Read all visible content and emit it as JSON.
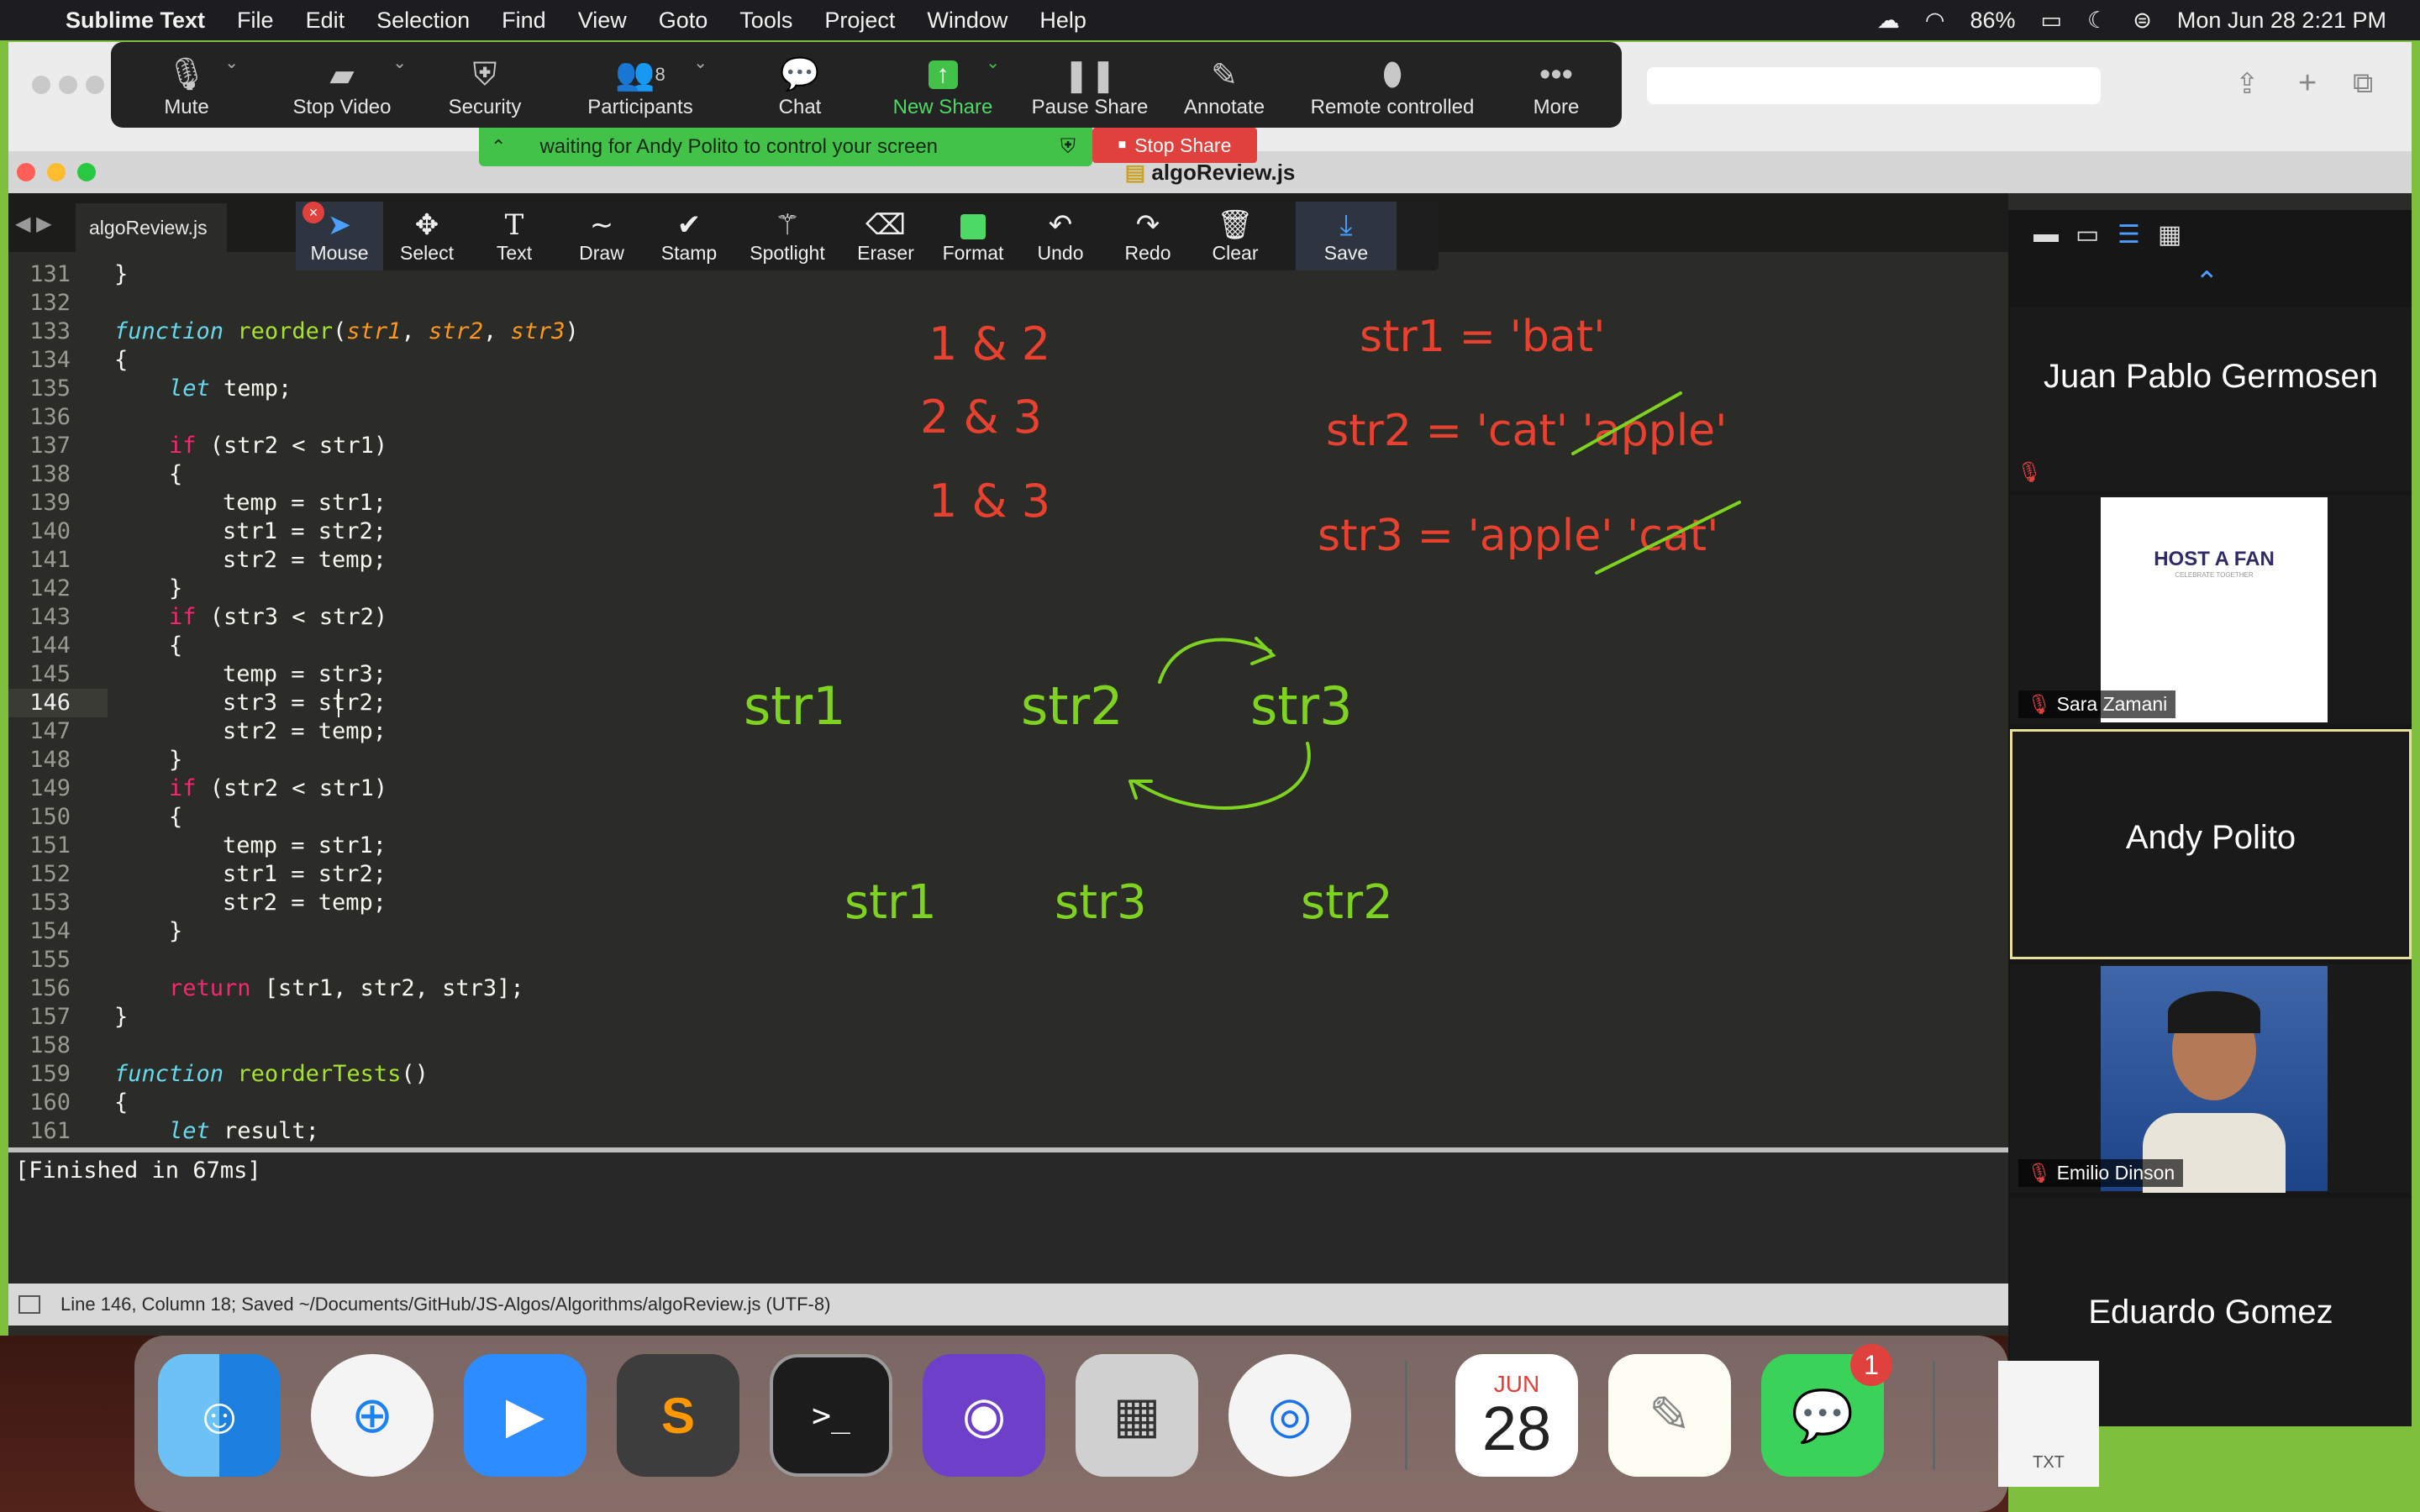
{
  "menubar": {
    "apple": "",
    "app_name": "Sublime Text",
    "items": [
      "File",
      "Edit",
      "Selection",
      "Find",
      "View",
      "Goto",
      "Tools",
      "Project",
      "Window",
      "Help"
    ],
    "battery": "86%",
    "datetime": "Mon Jun 28  2:21 PM"
  },
  "zoom_toolbar": {
    "buttons": [
      {
        "label": "Mute",
        "icon": "microphone-icon"
      },
      {
        "label": "Stop Video",
        "icon": "video-camera-icon"
      },
      {
        "label": "Security",
        "icon": "shield-icon"
      },
      {
        "label": "Participants",
        "icon": "participants-icon",
        "count": "8"
      },
      {
        "label": "Chat",
        "icon": "chat-bubble-icon"
      },
      {
        "label": "New Share",
        "icon": "share-up-arrow-icon"
      },
      {
        "label": "Pause Share",
        "icon": "pause-icon"
      },
      {
        "label": "Annotate",
        "icon": "pen-icon"
      },
      {
        "label": "Remote controlled",
        "icon": "mouse-icon"
      },
      {
        "label": "More",
        "icon": "more-dots-icon"
      }
    ]
  },
  "share_banner": {
    "text": "waiting for Andy Polito to control your screen",
    "stop_label": "Stop Share"
  },
  "window": {
    "title": "algoReview.js",
    "tab": "algoReview.js"
  },
  "annotate_toolbar": {
    "tools": [
      {
        "label": "Mouse",
        "icon": "cursor-arrow-icon"
      },
      {
        "label": "Select",
        "icon": "move-arrows-icon"
      },
      {
        "label": "Text",
        "icon": "text-T-icon"
      },
      {
        "label": "Draw",
        "icon": "squiggle-icon"
      },
      {
        "label": "Stamp",
        "icon": "checkmark-icon"
      },
      {
        "label": "Spotlight",
        "icon": "magic-wand-icon"
      },
      {
        "label": "Eraser",
        "icon": "eraser-icon"
      },
      {
        "label": "Format",
        "icon": "green-square-icon"
      },
      {
        "label": "Undo",
        "icon": "undo-icon"
      },
      {
        "label": "Redo",
        "icon": "redo-icon"
      },
      {
        "label": "Clear",
        "icon": "trash-icon"
      },
      {
        "label": "Save",
        "icon": "download-icon"
      }
    ]
  },
  "editor": {
    "line_numbers": [
      "131",
      "132",
      "133",
      "134",
      "135",
      "136",
      "137",
      "138",
      "139",
      "140",
      "141",
      "142",
      "143",
      "144",
      "145",
      "146",
      "147",
      "148",
      "149",
      "150",
      "151",
      "152",
      "153",
      "154",
      "155",
      "156",
      "157",
      "158",
      "159",
      "160",
      "161"
    ],
    "current_line": "146",
    "code": {
      "l131": "}",
      "l133_kw": "function",
      "l133_name": "reorder",
      "l133_p1": "str1",
      "l133_p2": "str2",
      "l133_p3": "str3",
      "open_brace": "{",
      "close_brace": "}",
      "let": "let",
      "temp_decl": " temp;",
      "if": "if",
      "cond1": " (str2 < str1)",
      "cond2": " (str3 < str2)",
      "temp_eq_str1": "temp = str1;",
      "str1_eq_str2": "str1 = str2;",
      "str2_eq_temp": "str2 = temp;",
      "temp_eq_str3": "temp = str3;",
      "str3_eq_str2": "str3 = str2;",
      "return": "return",
      "return_val": " [str1, str2, str3];",
      "l159_name": "reorderTests",
      "l159_tail": "()",
      "result_decl": " result;"
    }
  },
  "handwriting": {
    "red": [
      "1 & 2",
      "2 & 3",
      "1 & 3",
      "str1 = 'bat'",
      "str2 = 'cat' 'apple'",
      "str3 = 'apple' 'cat'"
    ],
    "green": [
      "str1",
      "str2",
      "str3",
      "str1",
      "str3",
      "str2"
    ]
  },
  "console": {
    "output": "[Finished in 67ms]"
  },
  "statusbar": {
    "text": "Line 146, Column 18; Saved ~/Documents/GitHub/JS-Algos/Algorithms/algoReview.js (UTF-8)"
  },
  "participants_panel": {
    "tiles": [
      {
        "name": "Juan Pablo Germosen"
      },
      {
        "name": "Sara Zamani",
        "logo_text": "HOST A FAN",
        "logo_sub": "CELEBRATE TOGETHER"
      },
      {
        "name": "Andy Polito"
      },
      {
        "name": "Emilio Dinson"
      },
      {
        "name": "Eduardo Gomez"
      }
    ]
  },
  "dock": {
    "calendar_month": "JUN",
    "calendar_day": "28",
    "messages_badge": "1",
    "txt_label": "TXT",
    "apps": [
      "finder-icon",
      "safari-icon",
      "zoom-icon",
      "sublime-text-icon",
      "terminal-icon",
      "github-desktop-icon",
      "calculator-icon",
      "chrome-icon",
      "calendar-icon",
      "textedit-icon",
      "messages-icon"
    ]
  },
  "colors": {
    "annotation_red": "#e8412f",
    "annotation_green": "#7ed321",
    "zoom_green": "#43c24a",
    "stop_red": "#e1413d"
  }
}
